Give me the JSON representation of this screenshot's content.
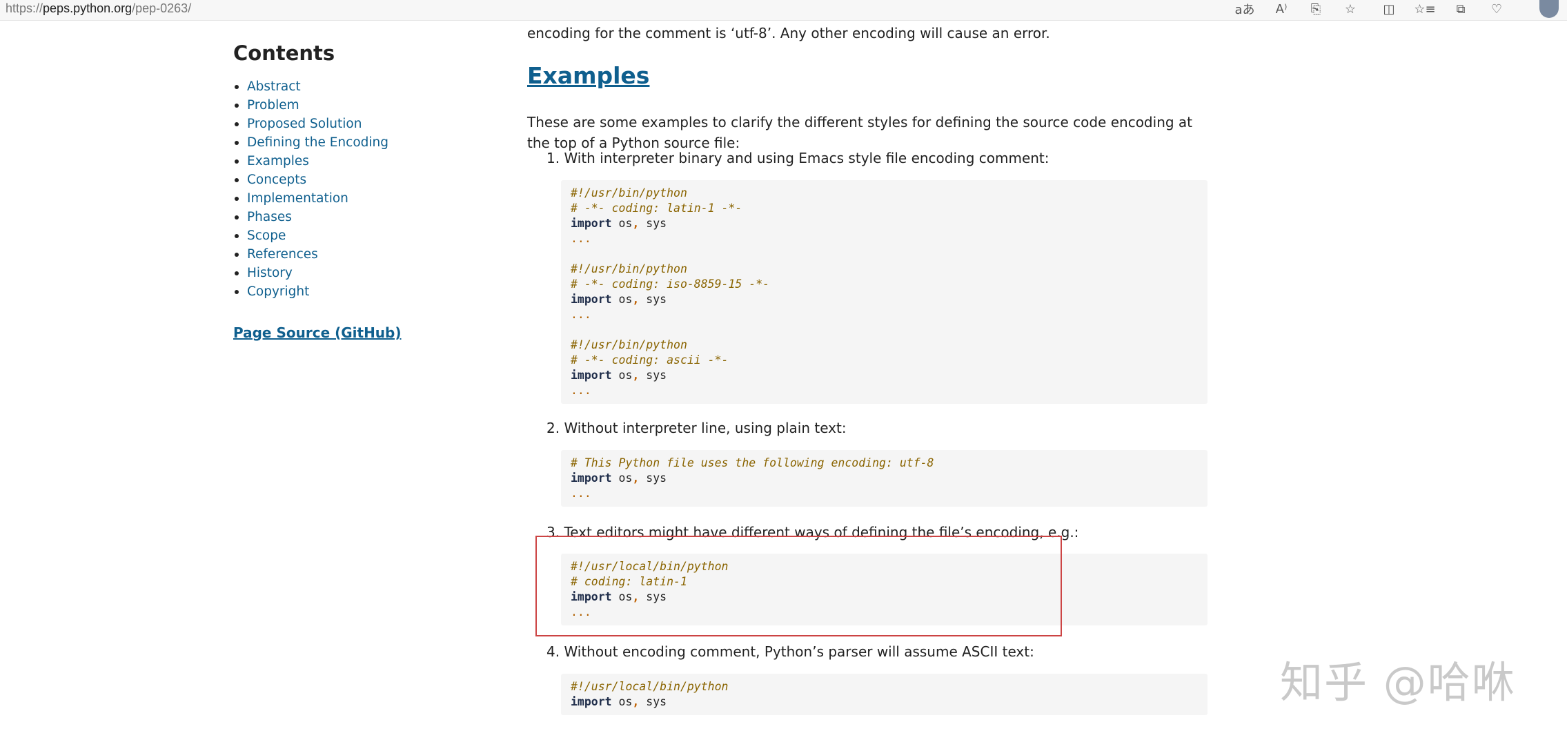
{
  "browser": {
    "url_scheme": "https://",
    "url_host": "peps.python.org",
    "url_path": "/pep-0263/",
    "toolbar_icons": [
      "translate-icon",
      "read-aloud-icon",
      "immersive-reader-icon",
      "favorite-star-icon",
      "split-screen-icon",
      "favorites-icon",
      "collections-icon",
      "browser-essentials-icon",
      "profile-avatar-icon"
    ],
    "toolbar_glyphs": [
      "aあ",
      "A⁾",
      "⎘",
      "☆",
      "◫",
      "☆≡",
      "⧉",
      "♡",
      ""
    ]
  },
  "sidebar": {
    "title": "Contents",
    "items": [
      {
        "label": "Abstract"
      },
      {
        "label": "Problem"
      },
      {
        "label": "Proposed Solution"
      },
      {
        "label": "Defining the Encoding"
      },
      {
        "label": "Examples"
      },
      {
        "label": "Concepts"
      },
      {
        "label": "Implementation"
      },
      {
        "label": "Phases"
      },
      {
        "label": "Scope"
      },
      {
        "label": "References"
      },
      {
        "label": "History"
      },
      {
        "label": "Copyright"
      }
    ],
    "page_source_label": "Page Source (GitHub)"
  },
  "main": {
    "intro_tail": "encoding for the comment is ‘utf-8’. Any other encoding will cause an error.",
    "section_title": "Examples",
    "examples_intro": "These are some examples to clarify the different styles for defining the source code encoding at the top of a Python source file:",
    "examples": [
      {
        "label": "1. With interpreter binary and using Emacs style file encoding comment:",
        "code": [
          [
            "#!/usr/bin/python"
          ],
          [
            "# -*- coding: latin-1 -*-"
          ],
          [
            "import",
            "os",
            "sys"
          ],
          [
            "..."
          ],
          [
            ""
          ],
          [
            "#!/usr/bin/python"
          ],
          [
            "# -*- coding: iso-8859-15 -*-"
          ],
          [
            "import",
            "os",
            "sys"
          ],
          [
            "..."
          ],
          [
            ""
          ],
          [
            "#!/usr/bin/python"
          ],
          [
            "# -*- coding: ascii -*-"
          ],
          [
            "import",
            "os",
            "sys"
          ],
          [
            "..."
          ]
        ]
      },
      {
        "label": "2. Without interpreter line, using plain text:",
        "code": [
          [
            "# This Python file uses the following encoding: utf-8"
          ],
          [
            "import",
            "os",
            "sys"
          ],
          [
            "..."
          ]
        ]
      },
      {
        "label": "3. Text editors might have different ways of defining the file’s encoding, e.g.:",
        "code": [
          [
            "#!/usr/local/bin/python"
          ],
          [
            "# coding: latin-1"
          ],
          [
            "import",
            "os",
            "sys"
          ],
          [
            "..."
          ]
        ]
      },
      {
        "label": "4. Without encoding comment, Python’s parser will assume ASCII text:",
        "code": [
          [
            "#!/usr/local/bin/python"
          ],
          [
            "import",
            "os",
            "sys"
          ]
        ]
      }
    ]
  },
  "watermark": "知乎 @哈咻",
  "colors": {
    "link": "#0f5f8e",
    "comment": "#8a6400",
    "code_bg": "#f5f5f5",
    "highlight_border": "#cc4444"
  }
}
